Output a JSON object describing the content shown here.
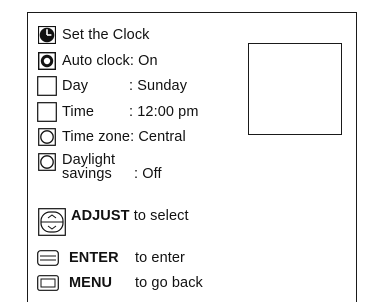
{
  "menu": {
    "title": "Set the Clock",
    "items": [
      {
        "label": "Auto clock",
        "separator": ": ",
        "value": "On"
      },
      {
        "label": "Day",
        "separator": ": ",
        "value": "Sunday"
      },
      {
        "label": "Time",
        "separator": ": ",
        "value": "12:00 pm"
      },
      {
        "label": "Time zone",
        "separator": ": ",
        "value": "Central"
      },
      {
        "label_line1": "Daylight",
        "label_line2": "savings",
        "separator": ": ",
        "value": "Off"
      }
    ]
  },
  "help": {
    "adjust_key": "ADJUST",
    "adjust_text": "to select",
    "enter_key": "ENTER",
    "enter_text": "to enter",
    "menu_key": "MENU",
    "menu_text": "to go back"
  },
  "icons": {
    "title": "clock-icon",
    "auto_clock": "circle-selected-icon",
    "day": "square-empty-icon",
    "time": "square-empty-icon",
    "time_zone": "circle-empty-icon",
    "daylight": "circle-empty-icon",
    "adjust": "adjust-rocker-icon",
    "enter": "enter-button-icon",
    "menu": "menu-button-icon"
  }
}
